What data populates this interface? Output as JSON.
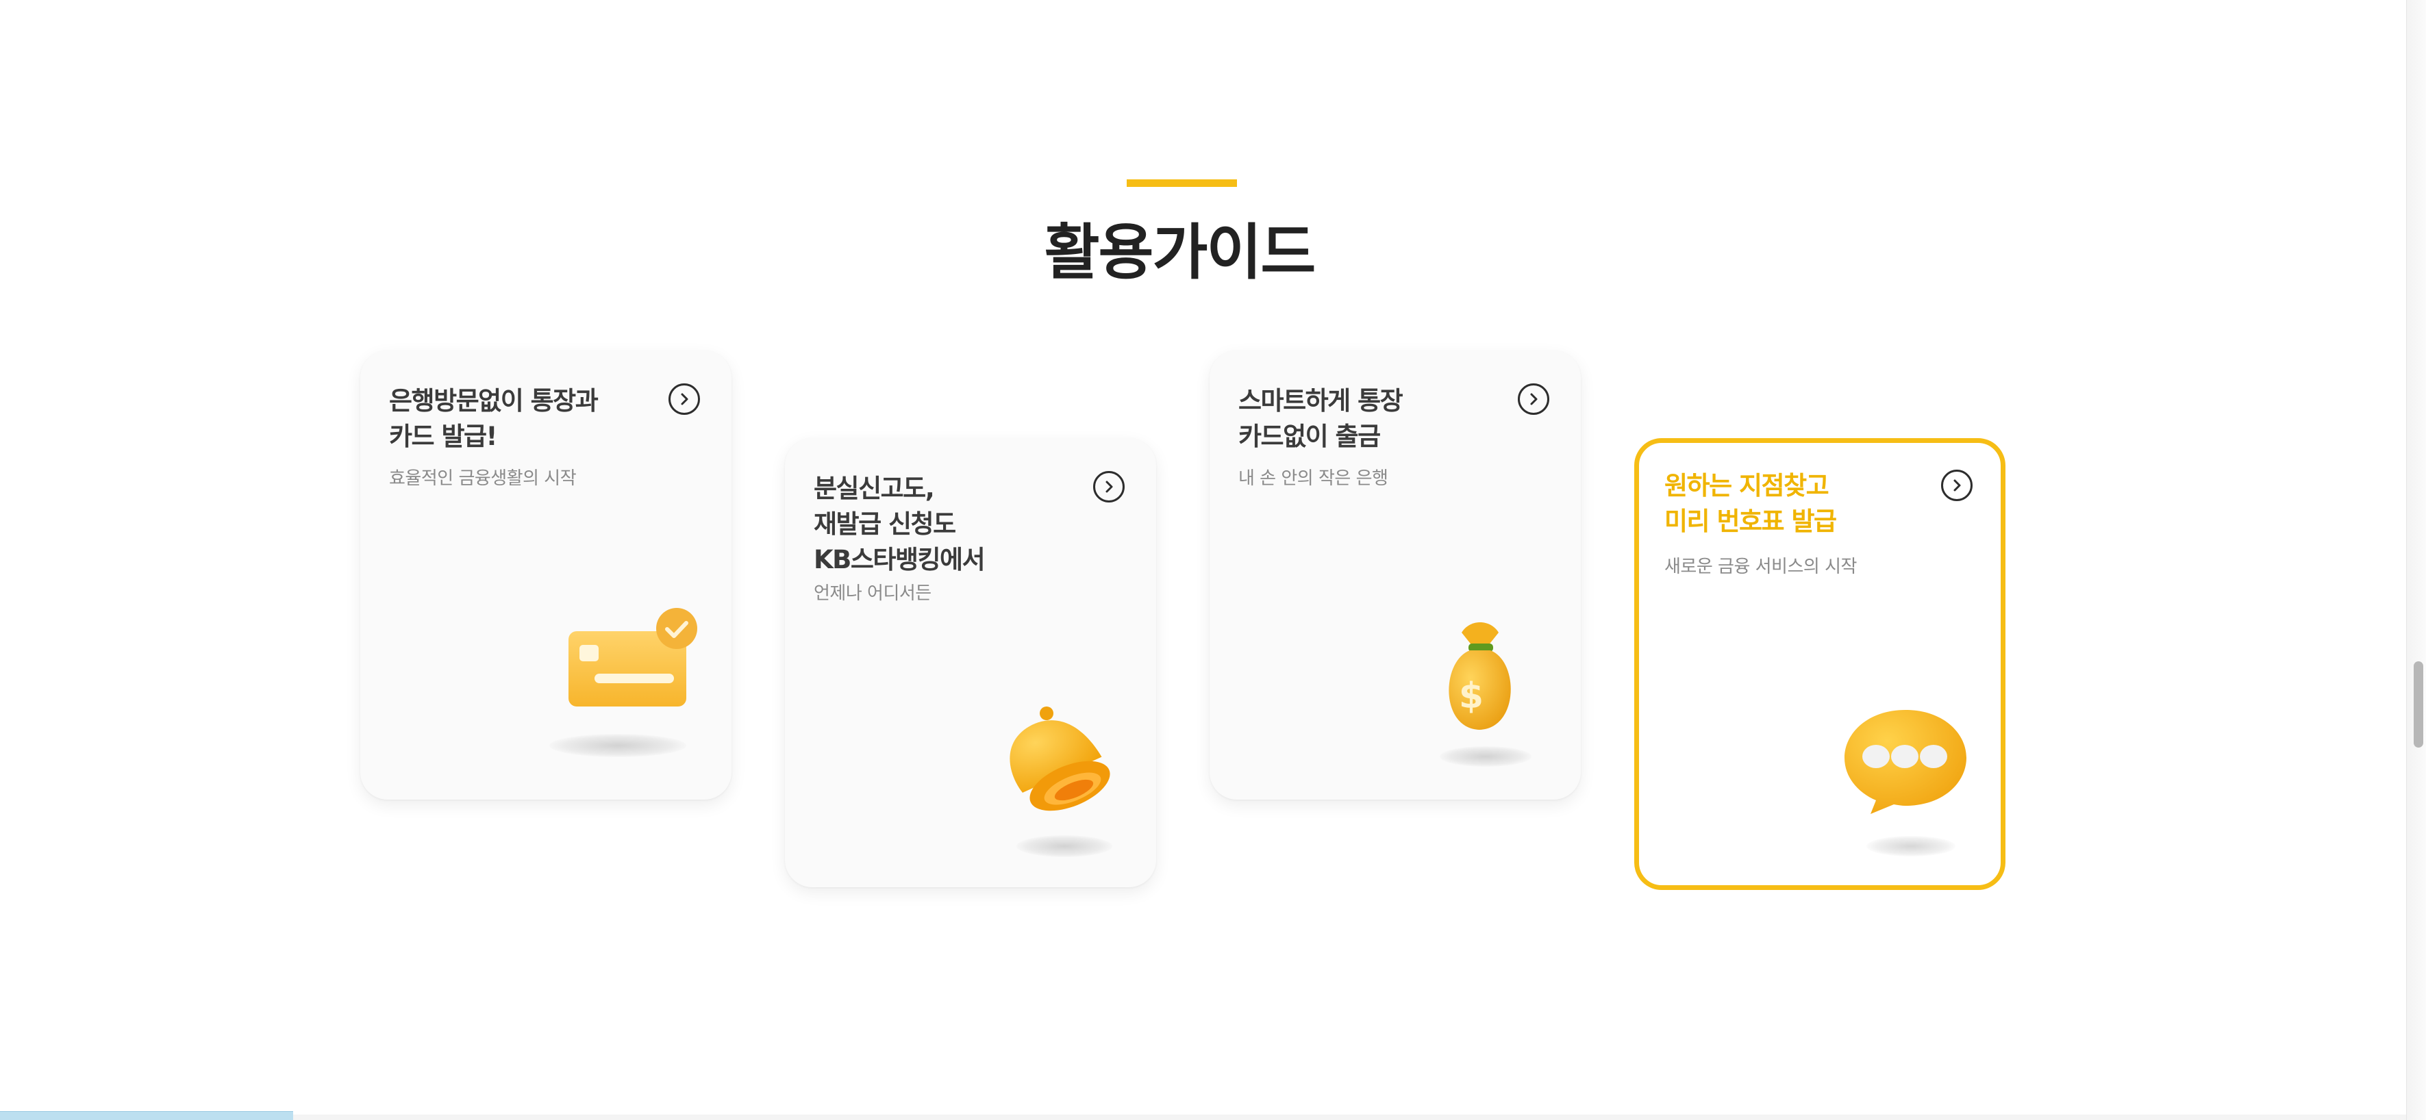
{
  "section": {
    "title": "활용가이드",
    "accent_color": "#f6bd15"
  },
  "cards": [
    {
      "title_lines": [
        "은행방문없이 통장과",
        "카드 발급!"
      ],
      "subtitle": "효율적인 금융생활의 시작",
      "icon": "credit-card-check-icon",
      "arrow_icon": "chevron-right-circle-icon"
    },
    {
      "title_lines": [
        "분실신고도,",
        "재발급 신청도",
        "KB스타뱅킹에서"
      ],
      "subtitle": "언제나 어디서든",
      "icon": "bell-icon",
      "arrow_icon": "chevron-right-circle-icon"
    },
    {
      "title_lines": [
        "스마트하게 통장",
        "카드없이 출금"
      ],
      "subtitle": "내 손 안의 작은 은행",
      "icon": "money-bag-icon",
      "arrow_icon": "chevron-right-circle-icon"
    },
    {
      "title_lines": [
        "원하는 지점찾고",
        "미리 번호표 발급"
      ],
      "subtitle": "새로운 금융 서비스의 시작",
      "icon": "speech-bubble-icon",
      "arrow_icon": "chevron-right-circle-icon",
      "active": true
    }
  ]
}
